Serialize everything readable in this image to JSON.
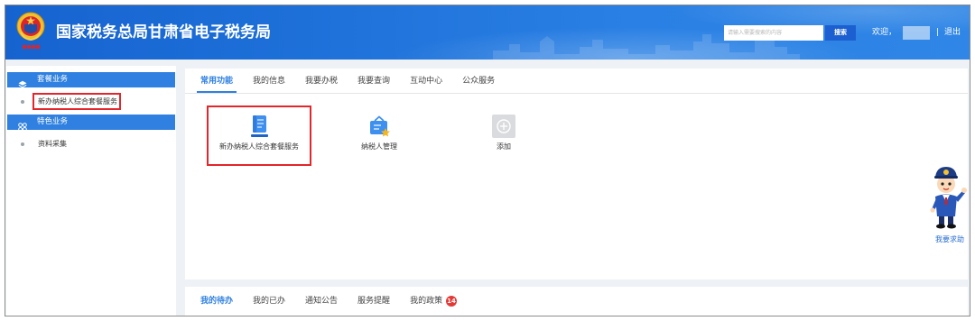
{
  "header": {
    "title": "国家税务总局甘肃省电子税务局",
    "emblem_icon": "tax-emblem-icon",
    "search": {
      "placeholder": "请输入需要搜索的内容",
      "button": "搜索"
    },
    "welcome": "欢迎，",
    "separator": "|",
    "logout": "退出"
  },
  "sidebar": {
    "groups": [
      {
        "label": "套餐业务",
        "icon": "layers-icon",
        "items": [
          {
            "label": "新办纳税人综合套餐服务",
            "highlighted": true
          }
        ]
      },
      {
        "label": "特色业务",
        "icon": "grid-icon",
        "items": [
          {
            "label": "资料采集",
            "highlighted": false
          }
        ]
      }
    ]
  },
  "main": {
    "tabs": [
      {
        "label": "常用功能",
        "active": true
      },
      {
        "label": "我的信息",
        "active": false
      },
      {
        "label": "我要办税",
        "active": false
      },
      {
        "label": "我要查询",
        "active": false
      },
      {
        "label": "互动中心",
        "active": false
      },
      {
        "label": "公众服务",
        "active": false
      }
    ],
    "tiles": [
      {
        "label": "新办纳税人综合套餐服务",
        "icon": "document-icon",
        "highlighted": true
      },
      {
        "label": "纳税人管理",
        "icon": "taxpayer-management-icon",
        "highlighted": false
      },
      {
        "label": "添加",
        "icon": "add-icon",
        "highlighted": false
      }
    ],
    "help": {
      "label": "我要求助",
      "icon": "mascot-icon"
    }
  },
  "bottom": {
    "tabs": [
      {
        "label": "我的待办",
        "active": true
      },
      {
        "label": "我的已办",
        "active": false
      },
      {
        "label": "通知公告",
        "active": false
      },
      {
        "label": "服务提醒",
        "active": false
      },
      {
        "label": "我的政策",
        "active": false,
        "badge": "14"
      }
    ]
  },
  "colors": {
    "accent": "#2f80e0",
    "header_start": "#1663d0",
    "header_end": "#2f86e6",
    "highlight": "#e3262b",
    "badge": "#e53935",
    "button": "#1c5fd0"
  }
}
